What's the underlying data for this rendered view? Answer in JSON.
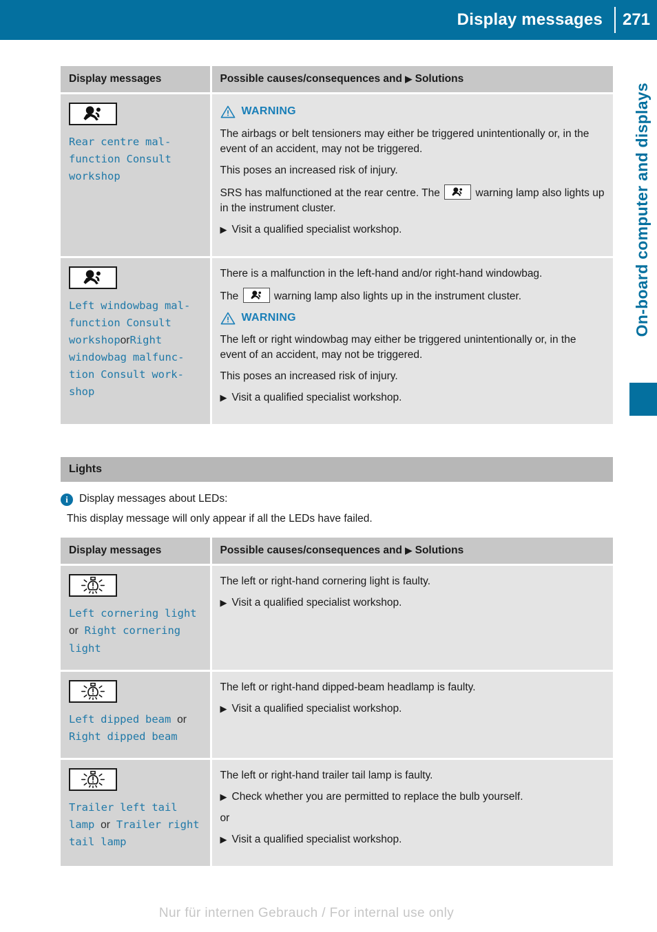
{
  "header": {
    "title": "Display messages",
    "page_number": "271"
  },
  "side_tab": {
    "chapter_label": "On-board computer and displays"
  },
  "table1": {
    "columns": {
      "left": "Display messages",
      "right_prefix": "Possible causes/consequences and",
      "right_suffix": "Solutions"
    },
    "rows": [
      {
        "icon": "airbag-icon",
        "message_lines": [
          {
            "text": "Rear centre mal‐",
            "style": "code"
          },
          {
            "text": "function Consult",
            "style": "code"
          },
          {
            "text": "workshop",
            "style": "code"
          }
        ],
        "warning_label": "WARNING",
        "paragraphs": [
          "The airbags or belt tensioners may either be triggered unintentionally or, in the event of an accident, may not be triggered.",
          "This poses an increased risk of injury."
        ],
        "lamp_sentence_before": "SRS has malfunctioned at the rear centre. The",
        "lamp_sentence_after": "warning lamp also lights up in the instrument cluster.",
        "steps": [
          "Visit a qualified specialist workshop."
        ]
      },
      {
        "icon": "airbag-icon",
        "message_lines": [
          {
            "text": "Left windowbag mal‐",
            "style": "code"
          },
          {
            "text": "function Consult",
            "style": "code"
          },
          {
            "text": "workshop",
            "style": "code"
          },
          {
            "text": "or",
            "style": "plain"
          },
          {
            "text": "Right windowbag malfunc‐tion Consult work‐shop",
            "style": "code"
          }
        ],
        "intro_paragraph": "There is a malfunction in the left-hand and/or right-hand windowbag.",
        "lamp_sentence_before": "The",
        "lamp_sentence_after": "warning lamp also lights up in the instrument cluster.",
        "warning_label": "WARNING",
        "paragraphs": [
          "The left or right windowbag may either be triggered unintentionally or, in the event of an accident, may not be triggered.",
          "This poses an increased risk of injury."
        ],
        "steps": [
          "Visit a qualified specialist workshop."
        ]
      }
    ]
  },
  "lights_section": {
    "banner": "Lights",
    "note_line1": "Display messages about LEDs:",
    "note_line2": "This display message will only appear if all the LEDs have failed."
  },
  "table2": {
    "columns": {
      "left": "Display messages",
      "right_prefix": "Possible causes/consequences and",
      "right_suffix": "Solutions"
    },
    "rows": [
      {
        "icon": "lamp-fault-icon",
        "message_parts": [
          {
            "text": "Left cornering light",
            "style": "code"
          },
          {
            "text": "or",
            "style": "plain"
          },
          {
            "text": "Right cornering light",
            "style": "code"
          }
        ],
        "cause": "The left or right-hand cornering light is faulty.",
        "steps": [
          "Visit a qualified specialist workshop."
        ]
      },
      {
        "icon": "lamp-fault-icon",
        "message_parts": [
          {
            "text": "Left dipped beam",
            "style": "code"
          },
          {
            "text": "or",
            "style": "plain"
          },
          {
            "text": "Right dipped beam",
            "style": "code"
          }
        ],
        "cause": "The left or right-hand dipped-beam headlamp is faulty.",
        "steps": [
          "Visit a qualified specialist workshop."
        ]
      },
      {
        "icon": "lamp-fault-icon",
        "message_parts": [
          {
            "text": "Trailer left tail lamp",
            "style": "code"
          },
          {
            "text": "or",
            "style": "plain"
          },
          {
            "text": "Trailer right tail lamp",
            "style": "code"
          }
        ],
        "cause": "The left or right-hand trailer tail lamp is faulty.",
        "steps": [
          "Check whether you are permitted to replace the bulb yourself.",
          "Visit a qualified specialist workshop."
        ],
        "step_separator": "or"
      }
    ]
  },
  "footer": {
    "text": "Nur für internen Gebrauch / For internal use only"
  },
  "colors": {
    "brand_blue": "#04709f",
    "code_teal": "#2079a8",
    "warning_blue": "#1a7fb8",
    "header_row_gray": "#c7c7c7",
    "left_cell_gray": "#d4d4d4",
    "right_cell_gray": "#e4e4e4",
    "banner_gray": "#b7b7b7",
    "footer_gray": "#c6c6c6"
  }
}
